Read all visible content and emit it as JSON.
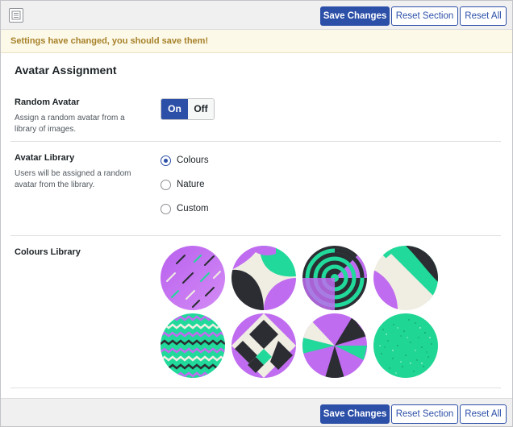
{
  "toolbar": {
    "save_label": "Save Changes",
    "reset_section_label": "Reset Section",
    "reset_all_label": "Reset All"
  },
  "notice": {
    "text": "Settings have changed, you should save them!"
  },
  "section": {
    "title": "Avatar Assignment"
  },
  "random_avatar": {
    "title": "Random Avatar",
    "description": "Assign a random avatar from a library of images.",
    "on_label": "On",
    "off_label": "Off",
    "state": "On"
  },
  "avatar_library": {
    "title": "Avatar Library",
    "description": "Users will be assigned a random avatar from the library.",
    "options": [
      {
        "label": "Colours",
        "checked": true
      },
      {
        "label": "Nature",
        "checked": false
      },
      {
        "label": "Custom",
        "checked": false
      }
    ]
  },
  "colours_library": {
    "title": "Colours Library",
    "avatars": [
      {
        "name": "purple-dashes"
      },
      {
        "name": "green-purple-curves"
      },
      {
        "name": "concentric-rings"
      },
      {
        "name": "split-diagonal"
      },
      {
        "name": "zigzag-stripes"
      },
      {
        "name": "diamond-blocks"
      },
      {
        "name": "pinwheel"
      },
      {
        "name": "green-speckle"
      }
    ]
  },
  "colors": {
    "primary": "#2c4fa8",
    "purple": "#c06cf0",
    "green": "#21d99a",
    "dark": "#2b2d33",
    "cream": "#f0ede2",
    "notice_text": "#a7812a",
    "notice_bg": "#fcf9e8"
  },
  "icons": {
    "menu": "list-icon"
  }
}
